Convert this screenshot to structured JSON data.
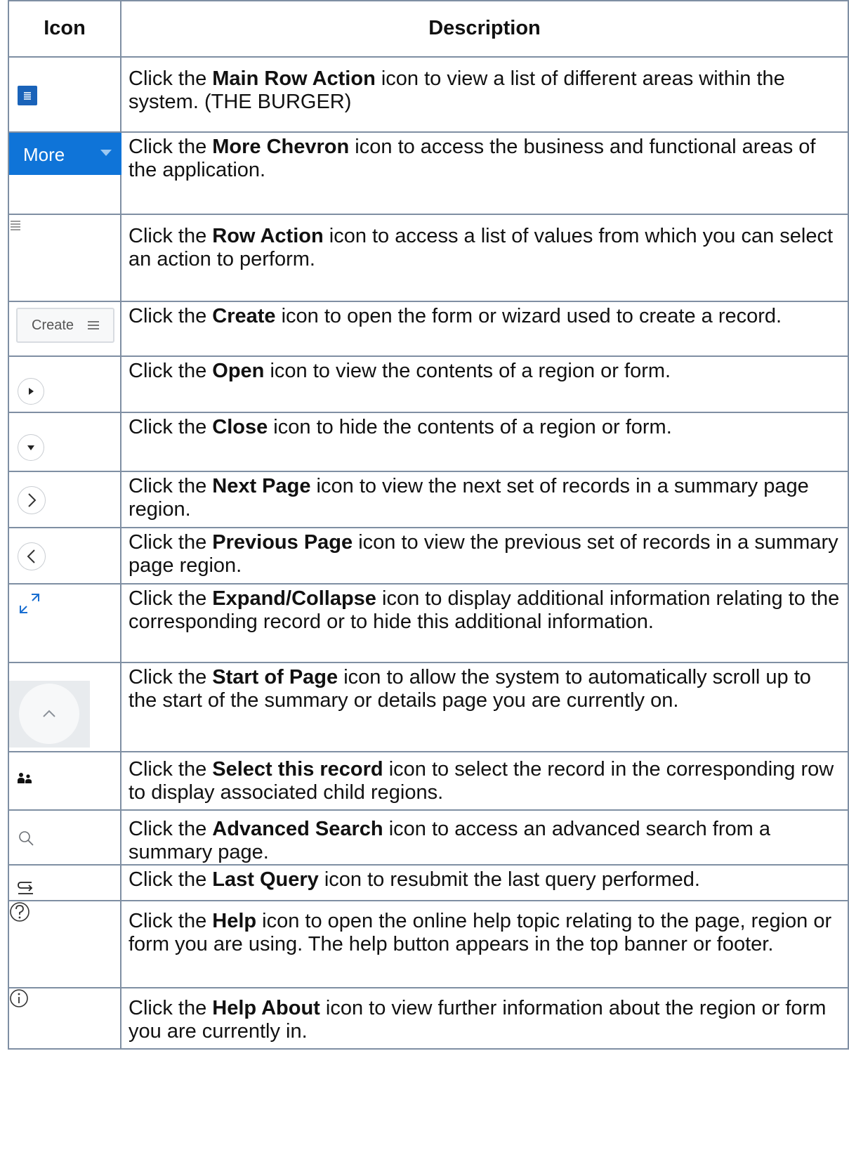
{
  "header": {
    "col_icon": "Icon",
    "col_description": "Description"
  },
  "rows": [
    {
      "icon": "burger-menu-icon",
      "pre": "Click the ",
      "bold": "Main Row Action",
      "post": " icon to view a list of different areas within the system. (THE BURGER)"
    },
    {
      "icon": "more-chevron-icon",
      "icon_label": "More",
      "pre": "Click the ",
      "bold": "More Chevron",
      "post": " icon to access the business and functional areas of the application."
    },
    {
      "icon": "row-action-icon",
      "pre": "Click the ",
      "bold": "Row Action",
      "post": " icon to access a list of values from which you can select an action to perform."
    },
    {
      "icon": "create-icon",
      "icon_label": "Create",
      "pre": "Click the ",
      "bold": "Create",
      "post": " icon to open the form or wizard used to create a record."
    },
    {
      "icon": "open-triangle-icon",
      "pre": "Click the ",
      "bold": "Open",
      "post": " icon to view the contents of a region or form."
    },
    {
      "icon": "close-triangle-icon",
      "pre": "Click the ",
      "bold": "Close",
      "post": " icon to hide the contents of a region or form."
    },
    {
      "icon": "next-page-icon",
      "pre": "Click the ",
      "bold": "Next Page",
      "post": " icon to view the next set of records in a summary page region."
    },
    {
      "icon": "previous-page-icon",
      "pre": "Click the ",
      "bold": "Previous Page",
      "post": " icon to view the previous set of records in a summary page region."
    },
    {
      "icon": "expand-collapse-icon",
      "pre": "Click the ",
      "bold": "Expand/Collapse",
      "post": " icon to display additional information relating to the corresponding record or to hide this additional information."
    },
    {
      "icon": "start-of-page-icon",
      "pre": "Click the ",
      "bold": "Start of Page",
      "post": " icon to allow the system to automatically scroll up to the start of the summary or details page you are currently on."
    },
    {
      "icon": "select-record-icon",
      "pre": "Click the ",
      "bold": "Select this record",
      "post": " icon to select the record in the corresponding row to display associated child regions."
    },
    {
      "icon": "search-icon",
      "pre": "Click the ",
      "bold": "Advanced Search",
      "post": " icon to access an advanced search from a summary page."
    },
    {
      "icon": "last-query-icon",
      "pre": "Click the ",
      "bold": "Last Query",
      "post": " icon to resubmit the last query performed."
    },
    {
      "icon": "help-icon",
      "pre": "Click the ",
      "bold": "Help",
      "post": " icon to open the online help topic relating to the page, region or form you are using. The help button appears in the top banner or footer."
    },
    {
      "icon": "info-icon",
      "pre": "Click the ",
      "bold": "Help About",
      "post": " icon to view further information about the region or form you are currently in."
    }
  ]
}
